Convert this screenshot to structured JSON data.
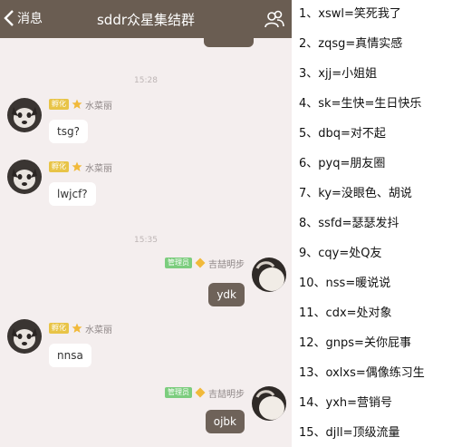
{
  "chat": {
    "back_label": "消息",
    "title": "sddr众星集结群",
    "timestamps": [
      "15:28",
      "15:35"
    ],
    "messages": [
      {
        "sender": "水菜丽",
        "rank": "孵化",
        "text": "tsg?"
      },
      {
        "sender": "水菜丽",
        "rank": "孵化",
        "text": "lwjcf?"
      },
      {
        "sender": "吉喆明步",
        "rank": "管理员",
        "text": "ydk"
      },
      {
        "sender": "水菜丽",
        "rank": "孵化",
        "text": "nnsa"
      },
      {
        "sender": "吉喆明步",
        "rank": "管理员",
        "text": "ojbk"
      }
    ],
    "colors": {
      "header": "#6a5d52",
      "background": "#f4eeee",
      "outgoing_bubble": "#6e6259",
      "rank_yellow": "#e8c447",
      "rank_green": "#7ccd7e"
    }
  },
  "glossary": {
    "items": [
      "1、xswl=笑死我了",
      "2、zqsg=真情实感",
      "3、xjj=小姐姐",
      "4、sk=生快=生日快乐",
      "5、dbq=对不起",
      "6、pyq=朋友圈",
      "7、ky=没眼色、胡说",
      "8、ssfd=瑟瑟发抖",
      "9、cqy=处Q友",
      "10、nss=暖说说",
      "11、cdx=处对象",
      "12、gnps=关你屁事",
      "13、oxlxs=偶像练习生",
      "14、yxh=营销号",
      "15、djll=顶级流量"
    ]
  }
}
